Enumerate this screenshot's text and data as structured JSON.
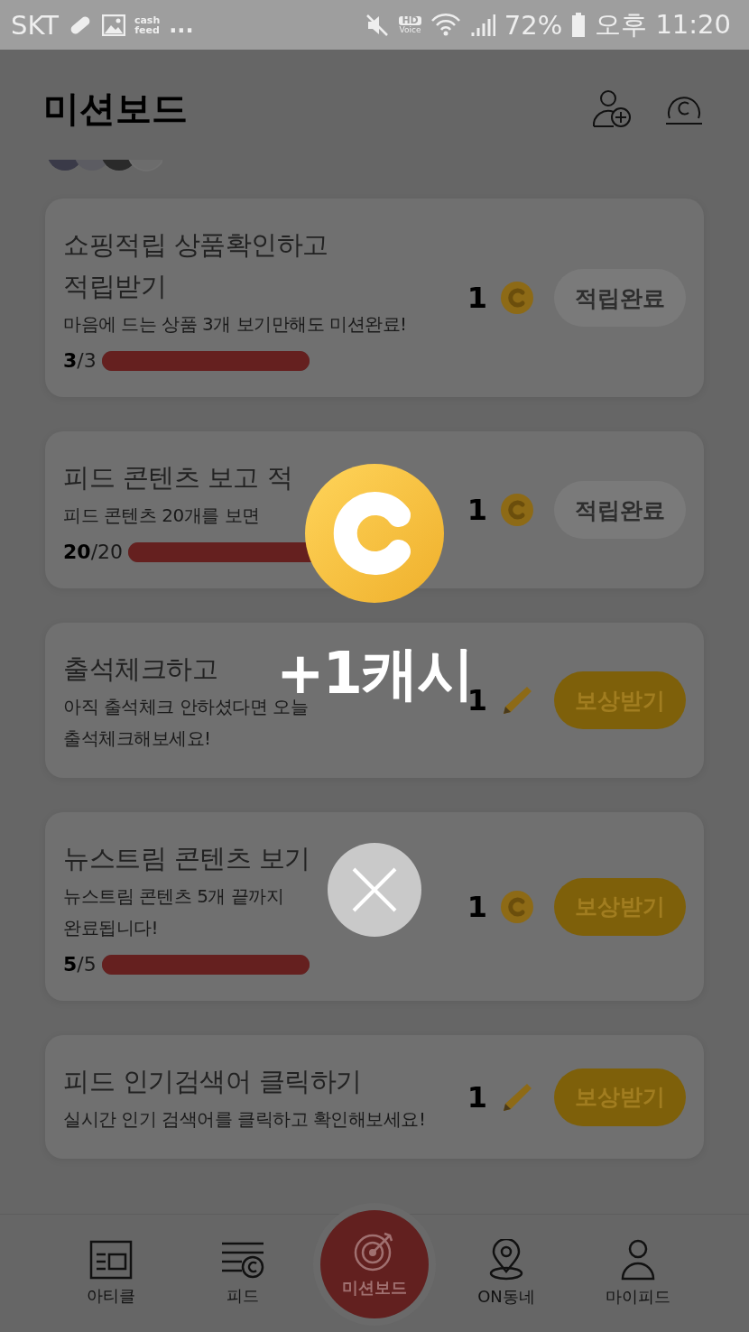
{
  "status_bar": {
    "carrier": "SKT",
    "app_icon_lines": [
      "cash",
      "feed"
    ],
    "more": "...",
    "hd_label": "HD",
    "voice_label": "Voice",
    "battery": "72%",
    "time": "오후 11:20"
  },
  "header": {
    "title": "미션보드"
  },
  "missions": [
    {
      "title": "쇼핑적립 상품확인하고 적립받기",
      "desc_lines": [
        "마음에 드는 상품 3개 보기만해도 미션완료!"
      ],
      "progress_done": "3",
      "progress_total": "/3",
      "level": 1,
      "reward": "1",
      "kind": "coin",
      "button": "적립완료",
      "completed": true
    },
    {
      "title": "피드 콘텐츠 보고 적",
      "desc_lines": [
        "피드 콘텐츠 20개를 보면"
      ],
      "progress_done": "20",
      "progress_total": "/20",
      "level": 1,
      "reward": "1",
      "kind": "coin",
      "button": "적립완료",
      "completed": true
    },
    {
      "title": "출석체크하고",
      "desc_lines": [
        "아직 출석체크 안하셨다면 오늘",
        "출석체크해보세요!"
      ],
      "reward": "1",
      "kind": "pencil",
      "button": "보상받기",
      "completed": false
    },
    {
      "title": "뉴스트림 콘텐츠 보기",
      "desc_lines": [
        "뉴스트림 콘텐츠 5개 끝까지",
        "완료됩니다!"
      ],
      "progress_done": "5",
      "progress_total": "/5",
      "level": 1,
      "reward": "1",
      "kind": "coin",
      "button": "보상받기",
      "completed": false
    },
    {
      "title": "피드 인기검색어 클릭하기",
      "desc_lines": [
        "실시간 인기 검색어를 클릭하고 확인해보세요!"
      ],
      "reward": "1",
      "kind": "pencil",
      "button": "보상받기",
      "completed": false
    }
  ],
  "popup": {
    "reward_text": "+1캐시"
  },
  "nav": [
    {
      "label": "아티클",
      "selected": false
    },
    {
      "label": "피드",
      "selected": false
    },
    {
      "label": "미션보드",
      "selected": true
    },
    {
      "label": "ON동네",
      "selected": false
    },
    {
      "label": "마이피드",
      "selected": false
    }
  ]
}
